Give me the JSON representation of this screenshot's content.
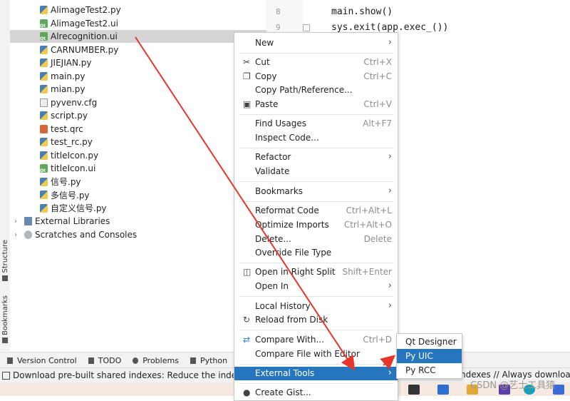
{
  "tool_strip": {
    "structure_label": "Structure",
    "bookmarks_label": "Bookmarks"
  },
  "project_tree": {
    "files": [
      {
        "name": "AlimageTest2.py",
        "icon": "python-file-icon"
      },
      {
        "name": "AlimageTest2.ui",
        "icon": "qt-ui-file-icon"
      },
      {
        "name": "Alrecognition.ui",
        "icon": "qt-ui-file-icon",
        "selected": true
      },
      {
        "name": "CARNUMBER.py",
        "icon": "python-file-icon"
      },
      {
        "name": "JIEJIAN.py",
        "icon": "python-file-icon"
      },
      {
        "name": "main.py",
        "icon": "python-file-icon"
      },
      {
        "name": "mian.py",
        "icon": "python-file-icon"
      },
      {
        "name": "pyvenv.cfg",
        "icon": "config-file-icon"
      },
      {
        "name": "script.py",
        "icon": "python-file-icon"
      },
      {
        "name": "test.qrc",
        "icon": "qrc-file-icon"
      },
      {
        "name": "test_rc.py",
        "icon": "python-file-icon"
      },
      {
        "name": "titleIcon.py",
        "icon": "python-file-icon"
      },
      {
        "name": "titleIcon.ui",
        "icon": "qt-ui-file-icon"
      },
      {
        "name": "信号.py",
        "icon": "python-file-icon"
      },
      {
        "name": "多信号.py",
        "icon": "python-file-icon"
      },
      {
        "name": "自定义信号.py",
        "icon": "python-file-icon"
      }
    ],
    "external_libraries": "External Libraries",
    "scratches": "Scratches and Consoles"
  },
  "editor": {
    "lines": [
      {
        "num": "8",
        "code": "main.show()"
      },
      {
        "num": "9",
        "code": "sys.exit(app.exec_())"
      }
    ]
  },
  "context_menu": {
    "items": {
      "new": {
        "label": "New",
        "submenu": true
      },
      "cut": {
        "label": "Cut",
        "shortcut": "Ctrl+X",
        "icon": "scissors-icon"
      },
      "copy": {
        "label": "Copy",
        "shortcut": "Ctrl+C",
        "icon": "copy-icon"
      },
      "copy_path": {
        "label": "Copy Path/Reference..."
      },
      "paste": {
        "label": "Paste",
        "shortcut": "Ctrl+V",
        "icon": "paste-icon"
      },
      "find_usages": {
        "label": "Find Usages",
        "shortcut": "Alt+F7"
      },
      "inspect_code": {
        "label": "Inspect Code..."
      },
      "refactor": {
        "label": "Refactor",
        "submenu": true
      },
      "validate": {
        "label": "Validate"
      },
      "bookmarks": {
        "label": "Bookmarks",
        "submenu": true
      },
      "reformat_code": {
        "label": "Reformat Code",
        "shortcut": "Ctrl+Alt+L"
      },
      "optimize_imports": {
        "label": "Optimize Imports",
        "shortcut": "Ctrl+Alt+O"
      },
      "delete": {
        "label": "Delete...",
        "shortcut": "Delete"
      },
      "override_file_type": {
        "label": "Override File Type"
      },
      "open_right_split": {
        "label": "Open in Right Split",
        "shortcut": "Shift+Enter",
        "icon": "split-icon"
      },
      "open_in": {
        "label": "Open In",
        "submenu": true
      },
      "local_history": {
        "label": "Local History",
        "submenu": true
      },
      "reload_disk": {
        "label": "Reload from Disk",
        "icon": "reload-icon"
      },
      "compare_with": {
        "label": "Compare With...",
        "shortcut": "Ctrl+D",
        "icon": "compare-icon"
      },
      "compare_editor": {
        "label": "Compare File with Editor"
      },
      "external_tools": {
        "label": "External Tools",
        "submenu": true,
        "active": true
      },
      "create_gist": {
        "label": "Create Gist...",
        "icon": "github-icon"
      }
    }
  },
  "submenu_external_tools": {
    "items": [
      {
        "label": "Qt Designer"
      },
      {
        "label": "Py UIC",
        "active": true
      },
      {
        "label": "Py RCC"
      }
    ]
  },
  "bottom_tool_bar": {
    "version_control": "Version Control",
    "todo": "TODO",
    "problems": "Problems",
    "python": "Python"
  },
  "status_bar": {
    "message": "Download pre-built shared indexes: Reduce the indexing",
    "message_right": "ndexes // Always download //"
  },
  "watermark": "CSDN @艺士工具猿",
  "colors": {
    "selection": "#2675bf",
    "annotation_arrow": "#e8352b",
    "tree_selected": "#d5d5d5"
  }
}
